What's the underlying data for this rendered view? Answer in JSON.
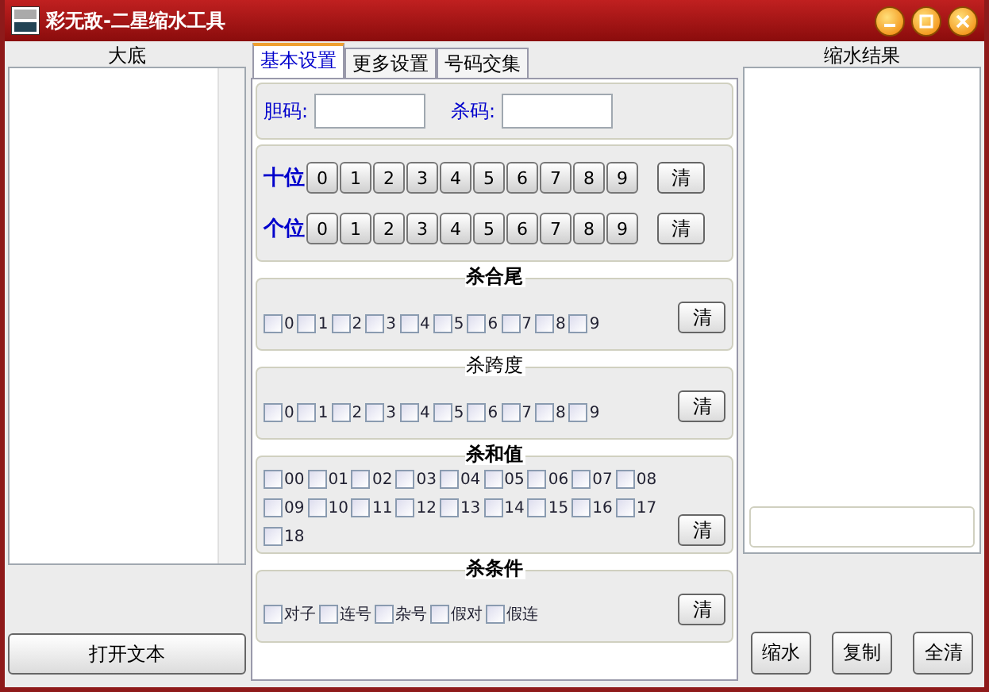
{
  "window": {
    "title": "彩无敌-二星缩水工具"
  },
  "left": {
    "title": "大底",
    "button": "打开文本"
  },
  "tabs": [
    {
      "label": "基本设置",
      "selected": true
    },
    {
      "label": "更多设置",
      "selected": false
    },
    {
      "label": "号码交集",
      "selected": false
    }
  ],
  "fields": [
    {
      "label": "胆码:"
    },
    {
      "label": "杀码:"
    }
  ],
  "digit_rows": [
    {
      "label": "十位",
      "digits": [
        "0",
        "1",
        "2",
        "3",
        "4",
        "5",
        "6",
        "7",
        "8",
        "9"
      ],
      "clear": "清"
    },
    {
      "label": "个位",
      "digits": [
        "0",
        "1",
        "2",
        "3",
        "4",
        "5",
        "6",
        "7",
        "8",
        "9"
      ],
      "clear": "清"
    }
  ],
  "groups": [
    {
      "title": "杀合尾",
      "bold": true,
      "clear": "清",
      "options": [
        {
          "label": "0",
          "checked": false
        },
        {
          "label": "1",
          "checked": false
        },
        {
          "label": "2",
          "checked": false
        },
        {
          "label": "3",
          "checked": false
        },
        {
          "label": "4",
          "checked": false
        },
        {
          "label": "5",
          "checked": false
        },
        {
          "label": "6",
          "checked": false
        },
        {
          "label": "7",
          "checked": false
        },
        {
          "label": "8",
          "checked": false
        },
        {
          "label": "9",
          "checked": false
        }
      ]
    },
    {
      "title": "杀跨度",
      "bold": false,
      "clear": "清",
      "options": [
        {
          "label": "0",
          "checked": false
        },
        {
          "label": "1",
          "checked": false
        },
        {
          "label": "2",
          "checked": false
        },
        {
          "label": "3",
          "checked": false
        },
        {
          "label": "4",
          "checked": false
        },
        {
          "label": "5",
          "checked": false
        },
        {
          "label": "6",
          "checked": false
        },
        {
          "label": "7",
          "checked": false
        },
        {
          "label": "8",
          "checked": false
        },
        {
          "label": "9",
          "checked": false
        }
      ]
    },
    {
      "title": "杀和值",
      "bold": true,
      "clear": "清",
      "options": [
        {
          "label": "00",
          "checked": false
        },
        {
          "label": "01",
          "checked": false
        },
        {
          "label": "02",
          "checked": false
        },
        {
          "label": "03",
          "checked": false
        },
        {
          "label": "04",
          "checked": false
        },
        {
          "label": "05",
          "checked": false
        },
        {
          "label": "06",
          "checked": false
        },
        {
          "label": "07",
          "checked": false
        },
        {
          "label": "08",
          "checked": false
        },
        {
          "label": "09",
          "checked": false
        },
        {
          "label": "10",
          "checked": false
        },
        {
          "label": "11",
          "checked": false
        },
        {
          "label": "12",
          "checked": false
        },
        {
          "label": "13",
          "checked": false
        },
        {
          "label": "14",
          "checked": false
        },
        {
          "label": "15",
          "checked": false
        },
        {
          "label": "16",
          "checked": false
        },
        {
          "label": "17",
          "checked": false
        },
        {
          "label": "18",
          "checked": false
        }
      ]
    },
    {
      "title": "杀条件",
      "bold": true,
      "clear": "清",
      "options": [
        {
          "label": "对子",
          "checked": false
        },
        {
          "label": "连号",
          "checked": false
        },
        {
          "label": "杂号",
          "checked": false
        },
        {
          "label": "假对",
          "checked": false
        },
        {
          "label": "假连",
          "checked": false
        }
      ]
    }
  ],
  "right": {
    "title": "缩水结果",
    "buttons": [
      "缩水",
      "复制",
      "全清"
    ]
  }
}
